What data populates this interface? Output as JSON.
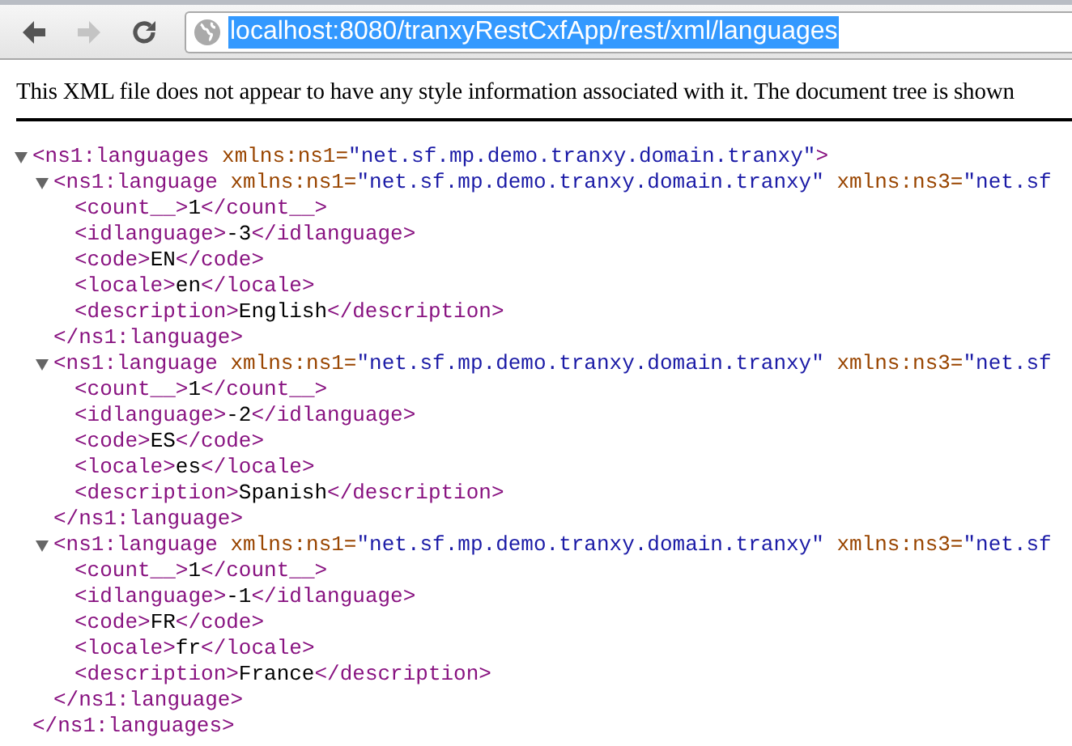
{
  "toolbar": {
    "back": {
      "disabled": false
    },
    "forward": {
      "disabled": true
    },
    "address_bar": {
      "url": "localhost:8080/tranxyRestCxfApp/rest/xml/languages",
      "selected": true
    }
  },
  "notice": "This XML file does not appear to have any style information associated with it. The document tree is shown",
  "tree": {
    "kind": "element",
    "expanded": true,
    "open": [
      {
        "kind": "tag",
        "text": "<ns1:languages"
      },
      {
        "kind": "attr_name",
        "text": " xmlns:ns1="
      },
      {
        "kind": "attr_value",
        "text": "\"net.sf.mp.demo.tranxy.domain.tranxy\""
      },
      {
        "kind": "tag",
        "text": ">"
      }
    ],
    "children": [
      {
        "kind": "element",
        "expanded": true,
        "open": [
          {
            "kind": "tag",
            "text": "<ns1:language"
          },
          {
            "kind": "attr_name",
            "text": " xmlns:ns1="
          },
          {
            "kind": "attr_value",
            "text": "\"net.sf.mp.demo.tranxy.domain.tranxy\""
          },
          {
            "kind": "attr_name",
            "text": " xmlns:ns3="
          },
          {
            "kind": "attr_value",
            "text": "\"net.sf"
          }
        ],
        "children": [
          {
            "kind": "leaf",
            "line": [
              {
                "kind": "tag",
                "text": "<count__>"
              },
              {
                "kind": "text",
                "text": "1"
              },
              {
                "kind": "tag",
                "text": "</count__>"
              }
            ]
          },
          {
            "kind": "leaf",
            "line": [
              {
                "kind": "tag",
                "text": "<idlanguage>"
              },
              {
                "kind": "text",
                "text": "-3"
              },
              {
                "kind": "tag",
                "text": "</idlanguage>"
              }
            ]
          },
          {
            "kind": "leaf",
            "line": [
              {
                "kind": "tag",
                "text": "<code>"
              },
              {
                "kind": "text",
                "text": "EN"
              },
              {
                "kind": "tag",
                "text": "</code>"
              }
            ]
          },
          {
            "kind": "leaf",
            "line": [
              {
                "kind": "tag",
                "text": "<locale>"
              },
              {
                "kind": "text",
                "text": "en"
              },
              {
                "kind": "tag",
                "text": "</locale>"
              }
            ]
          },
          {
            "kind": "leaf",
            "line": [
              {
                "kind": "tag",
                "text": "<description>"
              },
              {
                "kind": "text",
                "text": "English"
              },
              {
                "kind": "tag",
                "text": "</description>"
              }
            ]
          }
        ],
        "close": [
          {
            "kind": "tag",
            "text": "</ns1:language>"
          }
        ]
      },
      {
        "kind": "element",
        "expanded": true,
        "open": [
          {
            "kind": "tag",
            "text": "<ns1:language"
          },
          {
            "kind": "attr_name",
            "text": " xmlns:ns1="
          },
          {
            "kind": "attr_value",
            "text": "\"net.sf.mp.demo.tranxy.domain.tranxy\""
          },
          {
            "kind": "attr_name",
            "text": " xmlns:ns3="
          },
          {
            "kind": "attr_value",
            "text": "\"net.sf"
          }
        ],
        "children": [
          {
            "kind": "leaf",
            "line": [
              {
                "kind": "tag",
                "text": "<count__>"
              },
              {
                "kind": "text",
                "text": "1"
              },
              {
                "kind": "tag",
                "text": "</count__>"
              }
            ]
          },
          {
            "kind": "leaf",
            "line": [
              {
                "kind": "tag",
                "text": "<idlanguage>"
              },
              {
                "kind": "text",
                "text": "-2"
              },
              {
                "kind": "tag",
                "text": "</idlanguage>"
              }
            ]
          },
          {
            "kind": "leaf",
            "line": [
              {
                "kind": "tag",
                "text": "<code>"
              },
              {
                "kind": "text",
                "text": "ES"
              },
              {
                "kind": "tag",
                "text": "</code>"
              }
            ]
          },
          {
            "kind": "leaf",
            "line": [
              {
                "kind": "tag",
                "text": "<locale>"
              },
              {
                "kind": "text",
                "text": "es"
              },
              {
                "kind": "tag",
                "text": "</locale>"
              }
            ]
          },
          {
            "kind": "leaf",
            "line": [
              {
                "kind": "tag",
                "text": "<description>"
              },
              {
                "kind": "text",
                "text": "Spanish"
              },
              {
                "kind": "tag",
                "text": "</description>"
              }
            ]
          }
        ],
        "close": [
          {
            "kind": "tag",
            "text": "</ns1:language>"
          }
        ]
      },
      {
        "kind": "element",
        "expanded": true,
        "open": [
          {
            "kind": "tag",
            "text": "<ns1:language"
          },
          {
            "kind": "attr_name",
            "text": " xmlns:ns1="
          },
          {
            "kind": "attr_value",
            "text": "\"net.sf.mp.demo.tranxy.domain.tranxy\""
          },
          {
            "kind": "attr_name",
            "text": " xmlns:ns3="
          },
          {
            "kind": "attr_value",
            "text": "\"net.sf"
          }
        ],
        "children": [
          {
            "kind": "leaf",
            "line": [
              {
                "kind": "tag",
                "text": "<count__>"
              },
              {
                "kind": "text",
                "text": "1"
              },
              {
                "kind": "tag",
                "text": "</count__>"
              }
            ]
          },
          {
            "kind": "leaf",
            "line": [
              {
                "kind": "tag",
                "text": "<idlanguage>"
              },
              {
                "kind": "text",
                "text": "-1"
              },
              {
                "kind": "tag",
                "text": "</idlanguage>"
              }
            ]
          },
          {
            "kind": "leaf",
            "line": [
              {
                "kind": "tag",
                "text": "<code>"
              },
              {
                "kind": "text",
                "text": "FR"
              },
              {
                "kind": "tag",
                "text": "</code>"
              }
            ]
          },
          {
            "kind": "leaf",
            "line": [
              {
                "kind": "tag",
                "text": "<locale>"
              },
              {
                "kind": "text",
                "text": "fr"
              },
              {
                "kind": "tag",
                "text": "</locale>"
              }
            ]
          },
          {
            "kind": "leaf",
            "line": [
              {
                "kind": "tag",
                "text": "<description>"
              },
              {
                "kind": "text",
                "text": "France"
              },
              {
                "kind": "tag",
                "text": "</description>"
              }
            ]
          }
        ],
        "close": [
          {
            "kind": "tag",
            "text": "</ns1:language>"
          }
        ]
      }
    ],
    "close": [
      {
        "kind": "tag",
        "text": "</ns1:languages>"
      }
    ]
  }
}
